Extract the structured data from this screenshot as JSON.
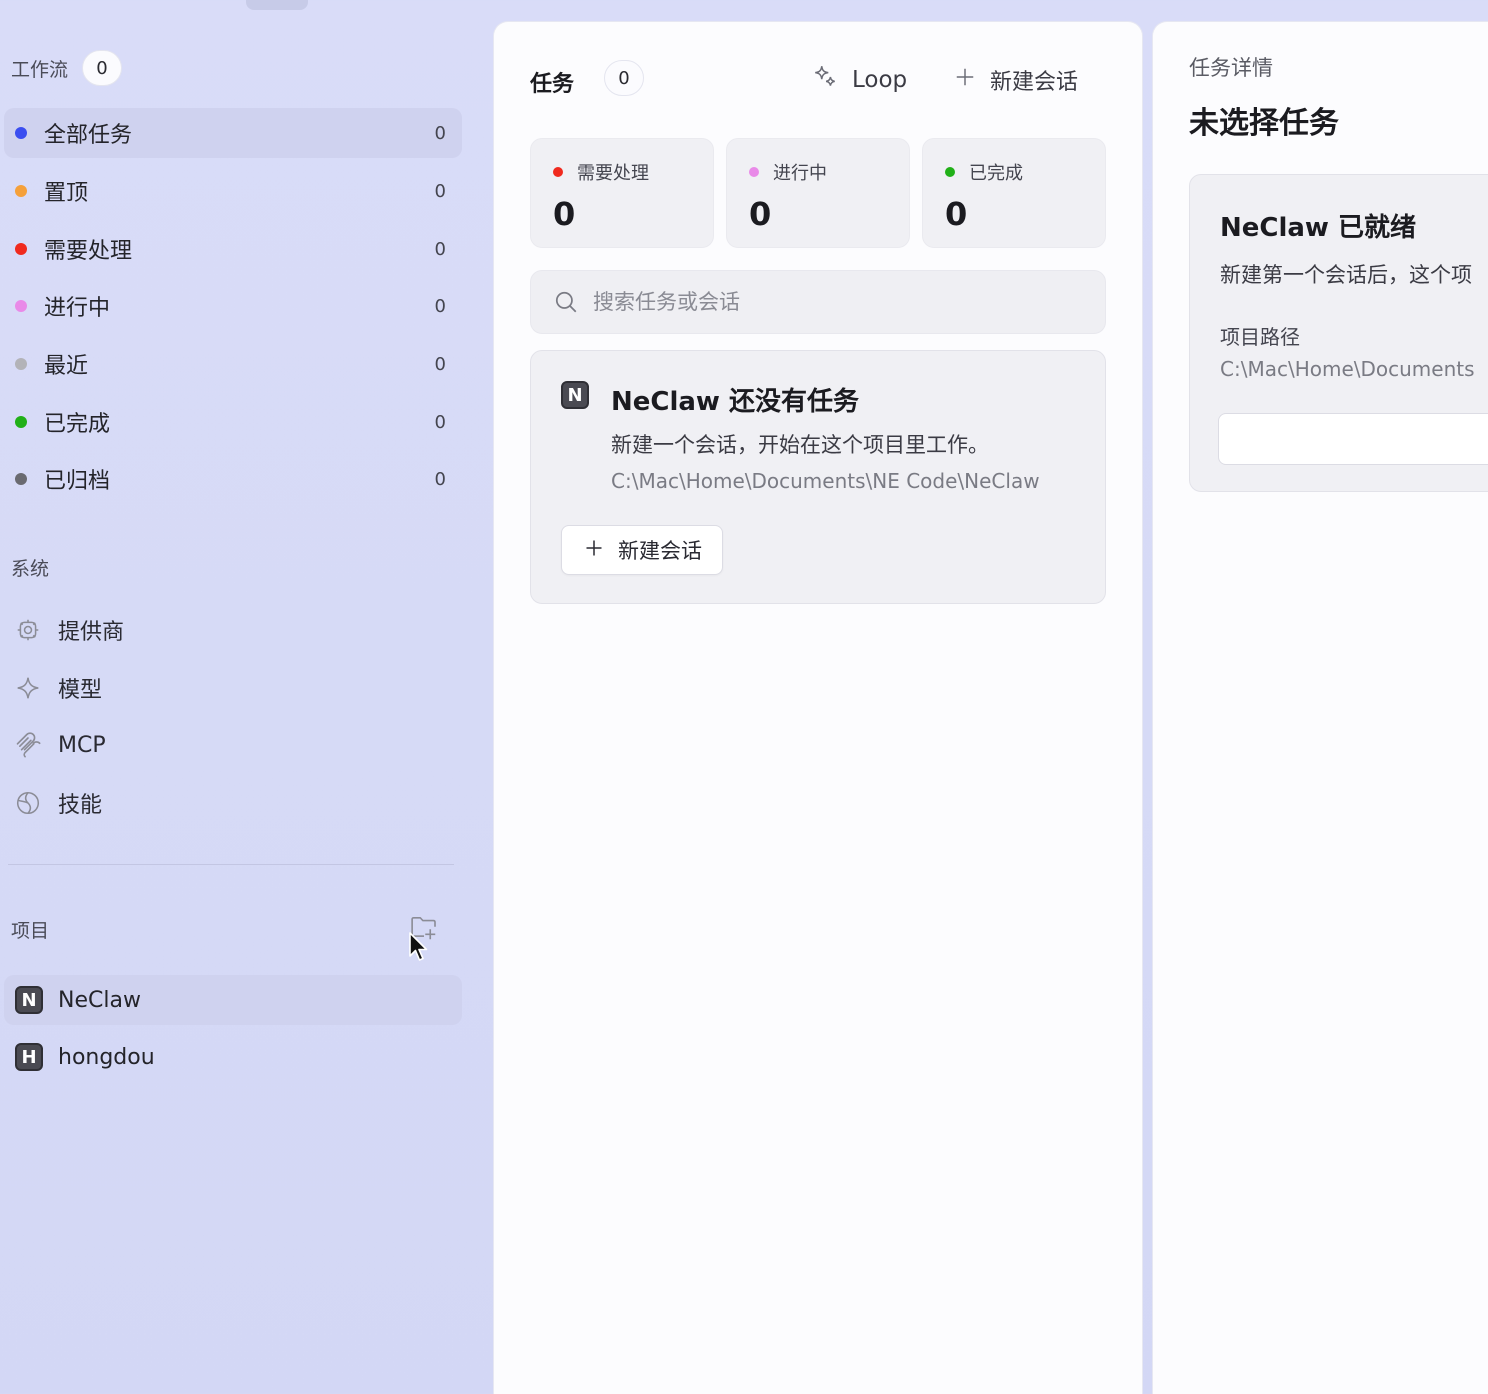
{
  "sidebar": {
    "workflow": {
      "title": "工作流",
      "count": "0",
      "items": [
        {
          "label": "全部任务",
          "count": "0",
          "color": "#3b4ef0"
        },
        {
          "label": "置顶",
          "count": "0",
          "color": "#f5a03a"
        },
        {
          "label": "需要处理",
          "count": "0",
          "color": "#f02a1e"
        },
        {
          "label": "进行中",
          "count": "0",
          "color": "#e98ae8"
        },
        {
          "label": "最近",
          "count": "0",
          "color": "#b3b3b8"
        },
        {
          "label": "已完成",
          "count": "0",
          "color": "#21b018"
        },
        {
          "label": "已归档",
          "count": "0",
          "color": "#6a6a70"
        }
      ]
    },
    "system": {
      "title": "系统",
      "items": [
        {
          "label": "提供商",
          "icon": "gear-icon"
        },
        {
          "label": "模型",
          "icon": "sparkle-icon"
        },
        {
          "label": "MCP",
          "icon": "mcp-icon"
        },
        {
          "label": "技能",
          "icon": "globe-icon"
        }
      ]
    },
    "projects": {
      "title": "项目",
      "add_icon": "folder-plus-icon",
      "items": [
        {
          "badge": "N",
          "label": "NeClaw"
        },
        {
          "badge": "H",
          "label": "hongdou"
        }
      ]
    }
  },
  "tasks": {
    "title": "任务",
    "count": "0",
    "loop_label": "Loop",
    "new_label": "新建会话",
    "stats": [
      {
        "label": "需要处理",
        "value": "0",
        "color": "#f02a1e"
      },
      {
        "label": "进行中",
        "value": "0",
        "color": "#e98ae8"
      },
      {
        "label": "已完成",
        "value": "0",
        "color": "#21b018"
      }
    ],
    "search_placeholder": "搜索任务或会话",
    "empty": {
      "badge": "N",
      "title": "NeClaw 还没有任务",
      "desc": "新建一个会话，开始在这个项目里工作。",
      "path": "C:\\Mac\\Home\\Documents\\NE Code\\NeClaw",
      "button": "新建会话"
    }
  },
  "detail": {
    "label": "任务详情",
    "title": "未选择任务",
    "card": {
      "title": "NeClaw 已就绪",
      "desc": "新建第一个会话后，这个项",
      "path_label": "项目路径",
      "path": "C:\\Mac\\Home\\Documents"
    }
  }
}
